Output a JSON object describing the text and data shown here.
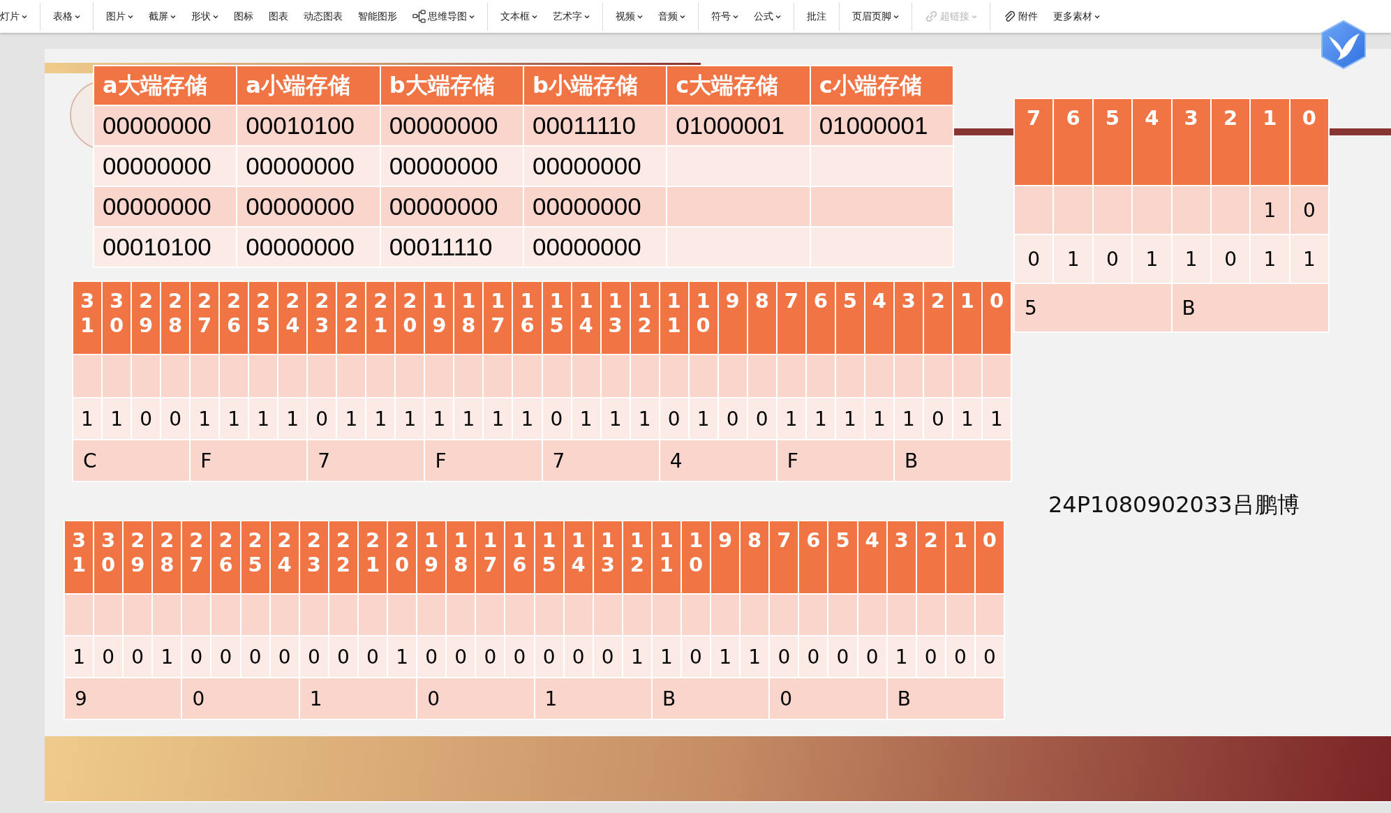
{
  "toolbar": {
    "groups": [
      [
        {
          "label": "灯片",
          "caret": true,
          "disabled": false,
          "kind": "text"
        }
      ],
      [
        {
          "label": "表格",
          "caret": true,
          "disabled": false,
          "kind": "text"
        }
      ],
      [
        {
          "label": "图片",
          "caret": true,
          "disabled": false,
          "kind": "text"
        },
        {
          "label": "截屏",
          "caret": true,
          "disabled": false,
          "kind": "text"
        },
        {
          "label": "形状",
          "caret": true,
          "disabled": false,
          "kind": "text"
        },
        {
          "label": "图标",
          "caret": false,
          "disabled": false,
          "kind": "text"
        },
        {
          "label": "图表",
          "caret": false,
          "disabled": false,
          "kind": "text"
        },
        {
          "label": "动态图表",
          "caret": false,
          "disabled": false,
          "kind": "text"
        },
        {
          "label": "智能图形",
          "caret": false,
          "disabled": false,
          "kind": "text"
        },
        {
          "label": "思维导图",
          "caret": true,
          "disabled": false,
          "kind": "mindmap"
        }
      ],
      [
        {
          "label": "文本框",
          "caret": true,
          "disabled": false,
          "kind": "text"
        },
        {
          "label": "艺术字",
          "caret": true,
          "disabled": false,
          "kind": "text"
        }
      ],
      [
        {
          "label": "视频",
          "caret": true,
          "disabled": false,
          "kind": "text"
        },
        {
          "label": "音频",
          "caret": true,
          "disabled": false,
          "kind": "text"
        }
      ],
      [
        {
          "label": "符号",
          "caret": true,
          "disabled": false,
          "kind": "text"
        },
        {
          "label": "公式",
          "caret": true,
          "disabled": false,
          "kind": "text"
        }
      ],
      [
        {
          "label": "批注",
          "caret": false,
          "disabled": false,
          "kind": "text"
        }
      ],
      [
        {
          "label": "页眉页脚",
          "caret": true,
          "disabled": false,
          "kind": "text"
        }
      ],
      [
        {
          "label": "超链接",
          "caret": true,
          "disabled": true,
          "kind": "link"
        }
      ],
      [
        {
          "label": "附件",
          "caret": false,
          "disabled": false,
          "kind": "attach"
        },
        {
          "label": "更多素材",
          "caret": true,
          "disabled": false,
          "kind": "text"
        }
      ]
    ]
  },
  "slide": {
    "storage_table": {
      "columns": [
        "a大端存储",
        "a小端存储",
        "b大端存储",
        "b小端存储",
        "c大端存储",
        "c小端存储"
      ],
      "rows": [
        [
          "00000000",
          "00010100",
          "00000000",
          "00011110",
          "01000001",
          "01000001"
        ],
        [
          "00000000",
          "00000000",
          "00000000",
          "00000000",
          null,
          null
        ],
        [
          "00000000",
          "00000000",
          "00000000",
          "00000000",
          null,
          null
        ],
        [
          "00010100",
          "00000000",
          "00011110",
          "00000000",
          null,
          null
        ]
      ]
    },
    "byte_table": {
      "columns": [
        "7",
        "6",
        "5",
        "4",
        "3",
        "2",
        "1",
        "0"
      ],
      "rows": [
        {
          "kind": "bits",
          "cells": [
            null,
            null,
            null,
            null,
            null,
            null,
            "1",
            "0"
          ]
        },
        {
          "kind": "bits",
          "cells": [
            "0",
            "1",
            "0",
            "1",
            "1",
            "0",
            "1",
            "1"
          ]
        },
        {
          "kind": "hex",
          "cells": [
            "5",
            null,
            null,
            null,
            "B",
            null,
            null,
            null
          ]
        }
      ]
    },
    "word_tables": [
      {
        "columns": [
          "31",
          "30",
          "29",
          "28",
          "27",
          "26",
          "25",
          "24",
          "23",
          "22",
          "21",
          "20",
          "19",
          "18",
          "17",
          "16",
          "15",
          "14",
          "13",
          "12",
          "11",
          "10",
          "9",
          "8",
          "7",
          "6",
          "5",
          "4",
          "3",
          "2",
          "1",
          "0"
        ],
        "rows": [
          {
            "kind": "blank"
          },
          {
            "kind": "bits",
            "cells": [
              "1",
              "1",
              "0",
              "0",
              "1",
              "1",
              "1",
              "1",
              "0",
              "1",
              "1",
              "1",
              "1",
              "1",
              "1",
              "1",
              "0",
              "1",
              "1",
              "1",
              "0",
              "1",
              "0",
              "0",
              "1",
              "1",
              "1",
              "1",
              "1",
              "0",
              "1",
              "1"
            ]
          },
          {
            "kind": "hex",
            "cells": [
              "C",
              null,
              null,
              null,
              "F",
              null,
              null,
              null,
              "7",
              null,
              null,
              null,
              "F",
              null,
              null,
              null,
              "7",
              null,
              null,
              null,
              "4",
              null,
              null,
              null,
              "F",
              null,
              null,
              null,
              "B",
              null,
              null,
              null
            ]
          }
        ]
      },
      {
        "columns": [
          "31",
          "30",
          "29",
          "28",
          "27",
          "26",
          "25",
          "24",
          "23",
          "22",
          "21",
          "20",
          "19",
          "18",
          "17",
          "16",
          "15",
          "14",
          "13",
          "12",
          "11",
          "10",
          "9",
          "8",
          "7",
          "6",
          "5",
          "4",
          "3",
          "2",
          "1",
          "0"
        ],
        "rows": [
          {
            "kind": "blank"
          },
          {
            "kind": "bits",
            "cells": [
              "1",
              "0",
              "0",
              "1",
              "0",
              "0",
              "0",
              "0",
              "0",
              "0",
              "0",
              "1",
              "0",
              "0",
              "0",
              "0",
              "0",
              "0",
              "0",
              "1",
              "1",
              "0",
              "1",
              "1",
              "0",
              "0",
              "0",
              "0",
              "1",
              "0",
              "0",
              "0"
            ]
          },
          {
            "kind": "hex",
            "cells": [
              "9",
              null,
              null,
              null,
              "0",
              null,
              null,
              null,
              "1",
              null,
              null,
              null,
              "0",
              null,
              null,
              null,
              "1",
              null,
              null,
              null,
              "B",
              null,
              null,
              null,
              "0",
              null,
              null,
              null,
              "B",
              null,
              null,
              null
            ]
          }
        ]
      }
    ],
    "author_label": "24P1080902033吕鹏博"
  }
}
